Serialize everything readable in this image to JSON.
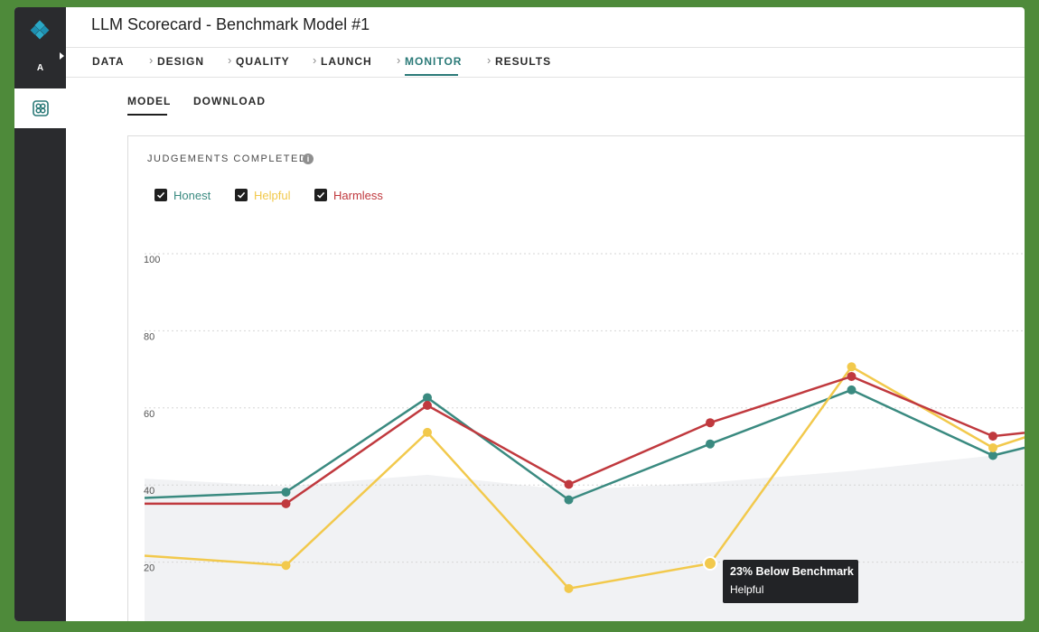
{
  "header": {
    "title": "LLM Scorecard - Benchmark Model #1"
  },
  "sidebar": {
    "letter": "A",
    "logo_icon": "diamond-logo-icon",
    "active_icon": "scorecard-icon",
    "colors": {
      "background": "#2a2b2e",
      "logo": "#2aa9c7",
      "active_icon": "#2b7a78"
    }
  },
  "steps": [
    {
      "label": "DATA",
      "active": false
    },
    {
      "label": "DESIGN",
      "active": false
    },
    {
      "label": "QUALITY",
      "active": false
    },
    {
      "label": "LAUNCH",
      "active": false
    },
    {
      "label": "MONITOR",
      "active": true
    },
    {
      "label": "RESULTS",
      "active": false
    }
  ],
  "subtabs": [
    {
      "label": "MODEL",
      "active": true
    },
    {
      "label": "DOWNLOAD",
      "active": false
    }
  ],
  "card": {
    "title": "JUDGEMENTS COMPLETED",
    "info_icon": "info-icon"
  },
  "legend": [
    {
      "label": "Honest",
      "color": "#3a8a80",
      "checked": true
    },
    {
      "label": "Helpful",
      "color": "#f2c94c",
      "checked": true
    },
    {
      "label": "Harmless",
      "color": "#c0393e",
      "checked": true
    }
  ],
  "chart_data": {
    "type": "line",
    "title": "JUDGEMENTS COMPLETED",
    "ylim": [
      0,
      100
    ],
    "yticks": [
      20,
      40,
      60,
      80,
      100
    ],
    "grid": true,
    "series": [
      {
        "name": "Honest",
        "color": "#3a8a80",
        "values": [
          39,
          40.5,
          65,
          38.5,
          53,
          67,
          50,
          59
        ]
      },
      {
        "name": "Helpful",
        "color": "#f2c94c",
        "values": [
          24,
          21.5,
          56,
          15.5,
          22,
          73,
          52,
          64
        ]
      },
      {
        "name": "Harmless",
        "color": "#c0393e",
        "values": [
          37.5,
          37.5,
          63,
          42.5,
          58.5,
          70.5,
          55,
          59
        ]
      }
    ],
    "area": {
      "color": "#f1f2f4",
      "values": [
        44,
        42,
        45,
        41,
        43,
        46,
        50,
        60
      ]
    },
    "tooltip": {
      "title": "23% Below Benchmark",
      "series": "Helpful",
      "point_index": 4
    }
  }
}
